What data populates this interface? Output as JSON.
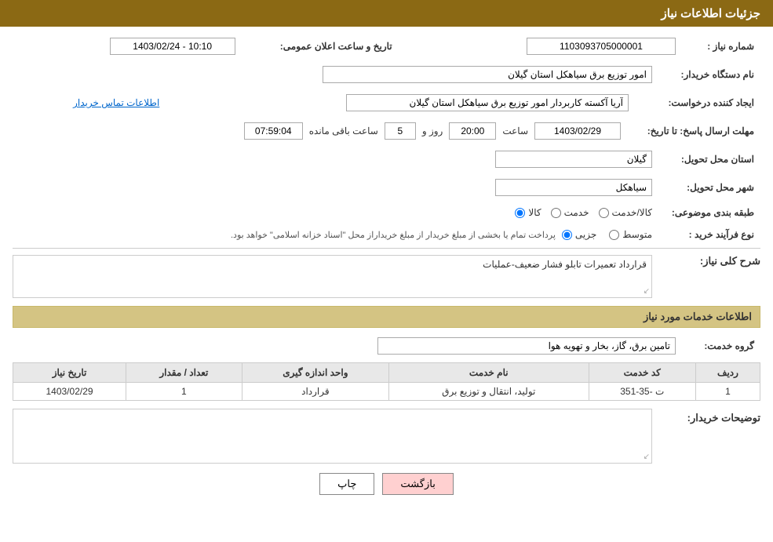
{
  "header": {
    "title": "جزئیات اطلاعات نیاز"
  },
  "form": {
    "need_number_label": "شماره نیاز :",
    "need_number_value": "1103093705000001",
    "org_name_label": "نام دستگاه خریدار:",
    "org_name_value": "امور توزیع برق سیاهکل استان گیلان",
    "announcement_datetime_label": "تاریخ و ساعت اعلان عمومی:",
    "announcement_datetime_value": "1403/02/24 - 10:10",
    "creator_label": "ایجاد کننده درخواست:",
    "creator_value": "آریا آکسته کاربردار امور توزیع برق سیاهکل استان گیلان",
    "contact_link": "اطلاعات تماس خریدار",
    "response_deadline_label": "مهلت ارسال پاسخ: تا تاریخ:",
    "response_date_value": "1403/02/29",
    "response_time_label": "ساعت",
    "response_time_value": "20:00",
    "days_label": "روز و",
    "days_value": "5",
    "remaining_label": "ساعت باقی مانده",
    "remaining_value": "07:59:04",
    "province_label": "استان محل تحویل:",
    "province_value": "گیلان",
    "city_label": "شهر محل تحویل:",
    "city_value": "سیاهکل",
    "category_label": "طبقه بندی موضوعی:",
    "category_kala": "کالا",
    "category_khadamat": "خدمت",
    "category_kala_khadamat": "کالا/خدمت",
    "purchase_type_label": "نوع فرآیند خرید :",
    "purchase_jozii": "جزیی",
    "purchase_mottaset": "متوسط",
    "purchase_desc": "پرداخت تمام یا بخشی از مبلغ خریدار از مبلغ خریداراز محل \"اسناد خزانه اسلامی\" خواهد بود.",
    "general_desc_label": "شرح کلی نیاز:",
    "general_desc_value": "قرارداد تعمیرات تابلو فشار ضعیف-عملیات",
    "services_section_label": "اطلاعات خدمات مورد نیاز",
    "service_group_label": "گروه خدمت:",
    "service_group_value": "تامین برق، گاز، بخار و تهویه هوا",
    "table": {
      "headers": [
        "ردیف",
        "کد خدمت",
        "نام خدمت",
        "واحد اندازه گیری",
        "تعداد / مقدار",
        "تاریخ نیاز"
      ],
      "rows": [
        {
          "row_num": "1",
          "service_code": "ت -35-351",
          "service_name": "تولید، انتقال و توزیع برق",
          "unit": "قرارداد",
          "quantity": "1",
          "date": "1403/02/29"
        }
      ]
    },
    "buyer_notes_label": "توضیحات خریدار:",
    "buyer_notes_value": "",
    "btn_print": "چاپ",
    "btn_back": "بازگشت"
  }
}
